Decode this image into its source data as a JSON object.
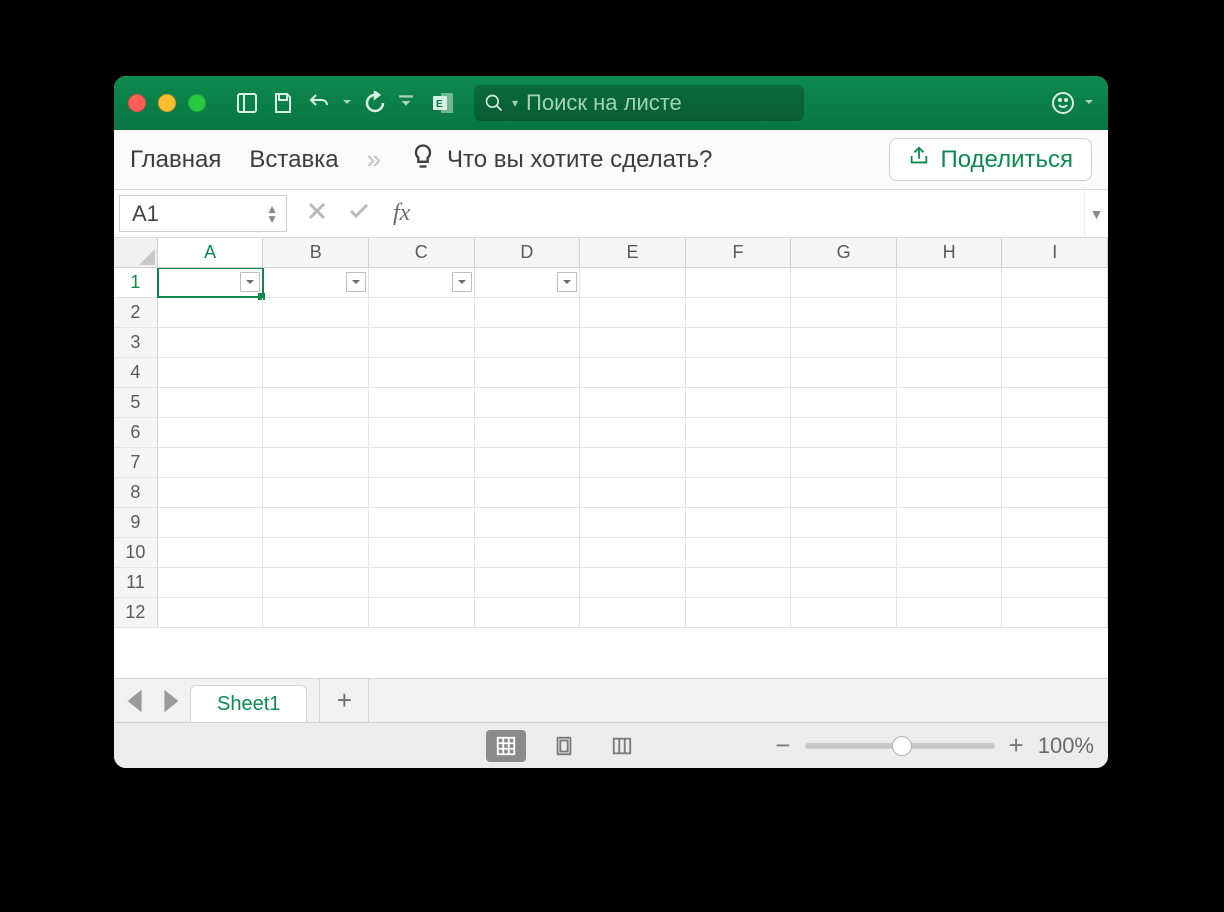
{
  "titlebar": {
    "search_placeholder": "Поиск на листе"
  },
  "ribbon": {
    "tabs": {
      "home": "Главная",
      "insert": "Вставка"
    },
    "more": "»",
    "tell_me": "Что вы хотите сделать?",
    "share": "Поделиться"
  },
  "formula": {
    "cell_ref": "A1",
    "fx_label": "fx",
    "value": ""
  },
  "grid": {
    "columns": [
      "A",
      "B",
      "C",
      "D",
      "E",
      "F",
      "G",
      "H",
      "I"
    ],
    "rows": [
      "1",
      "2",
      "3",
      "4",
      "5",
      "6",
      "7",
      "8",
      "9",
      "10",
      "11",
      "12"
    ],
    "active_col": "A",
    "active_row": "1",
    "filter_cols": [
      "A",
      "B",
      "C",
      "D"
    ]
  },
  "sheets": {
    "active": "Sheet1"
  },
  "status": {
    "zoom": "100%"
  },
  "colors": {
    "accent": "#0b8a4e"
  }
}
